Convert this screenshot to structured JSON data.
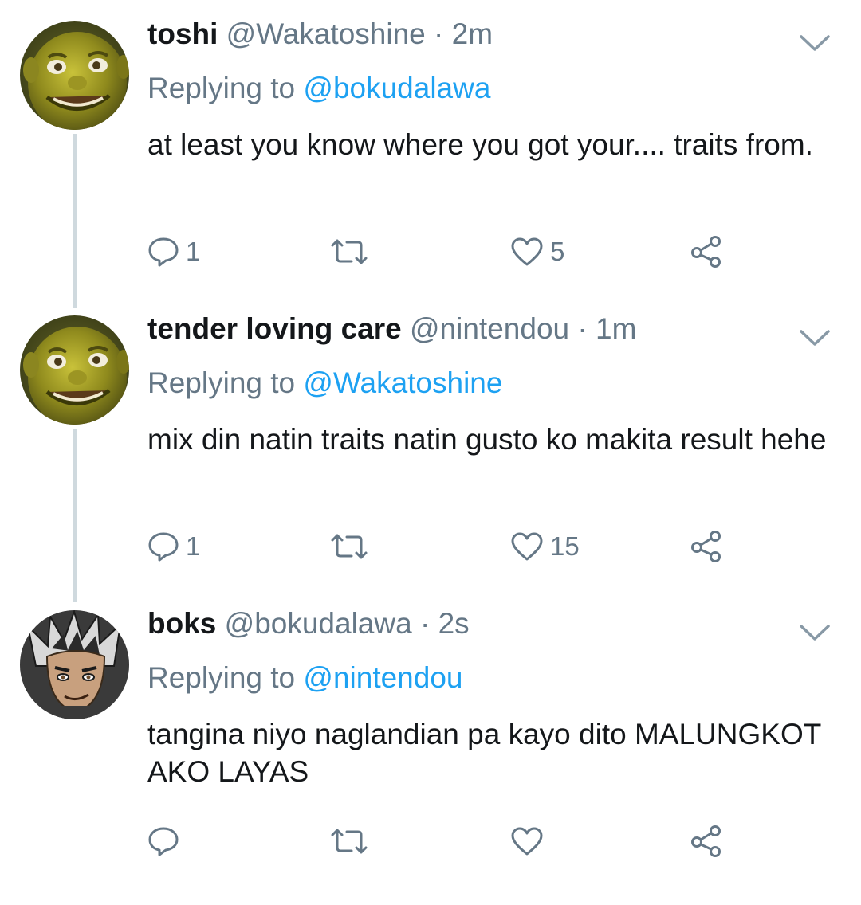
{
  "tweets": [
    {
      "name": "toshi",
      "handle": "@Wakatoshine",
      "separator": "·",
      "time": "2m",
      "replying_prefix": "Replying to",
      "replying_to": "@bokudalawa",
      "text": "at least you know where you got your.... traits from.",
      "reply_count": "1",
      "retweet_count": "",
      "like_count": "5",
      "avatar_icon": "shrek-face-avatar"
    },
    {
      "name": "tender loving care",
      "handle": "@nintendou",
      "separator": "·",
      "time": "1m",
      "replying_prefix": "Replying to",
      "replying_to": "@Wakatoshine",
      "text": "mix din natin traits natin gusto ko makita result hehe",
      "reply_count": "1",
      "retweet_count": "",
      "like_count": "15",
      "avatar_icon": "shrek-face-avatar"
    },
    {
      "name": "boks",
      "handle": "@bokudalawa",
      "separator": "·",
      "time": "2s",
      "replying_prefix": "Replying to",
      "replying_to": "@nintendou",
      "text": "tangina niyo naglandian pa kayo dito MALUNGKOT AKO LAYAS",
      "reply_count": "",
      "retweet_count": "",
      "like_count": "",
      "avatar_icon": "anime-character-avatar"
    }
  ],
  "colors": {
    "link_blue": "#1da1f2",
    "secondary_gray": "#657786",
    "thread_line": "#cfd9de",
    "text": "#14171a"
  }
}
